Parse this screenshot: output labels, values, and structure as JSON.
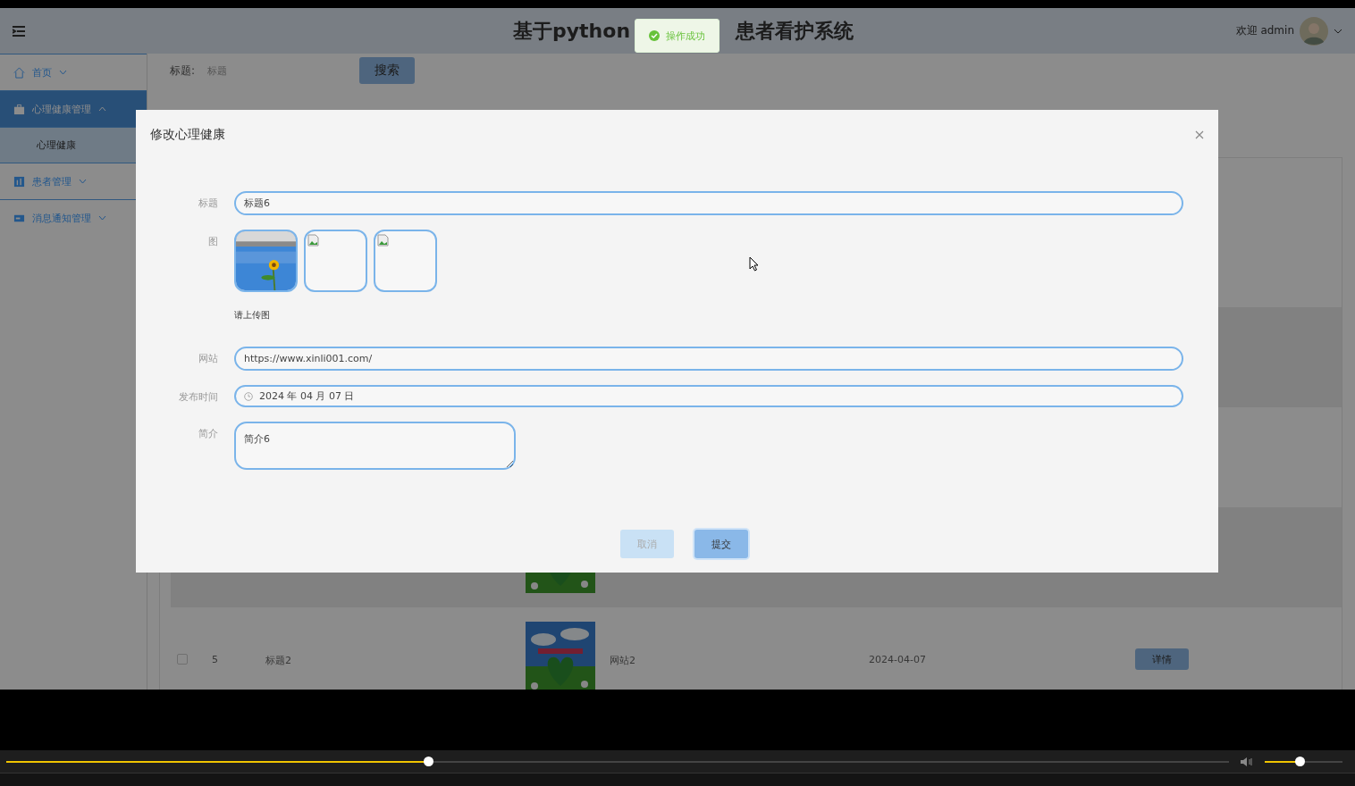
{
  "header": {
    "title_parts": [
      "基于python",
      "患者看护系统"
    ],
    "welcome": "欢迎 admin"
  },
  "toast": {
    "text": "操作成功"
  },
  "sidebar": {
    "items": [
      {
        "label": "首页",
        "kind": "home",
        "selected": false,
        "expanded": false
      },
      {
        "label": "心理健康管理",
        "kind": "briefcase",
        "selected": true,
        "expanded": true,
        "children": [
          {
            "label": "心理健康",
            "selected": false
          }
        ]
      },
      {
        "label": "患者管理",
        "kind": "chart",
        "selected": false,
        "expanded": false
      },
      {
        "label": "消息通知管理",
        "kind": "card",
        "selected": false,
        "expanded": false
      }
    ]
  },
  "search": {
    "label": "标题:",
    "placeholder": "标题",
    "button": "搜索"
  },
  "table": {
    "rows": [
      {
        "kind": "covered"
      },
      {
        "kind": "full",
        "checked": false,
        "index": "5",
        "title": "标题2",
        "site": "网站2",
        "date": "2024-04-07",
        "action": "详情"
      }
    ]
  },
  "dialog": {
    "title": "修改心理健康",
    "fields": [
      {
        "kind": "text",
        "label": "标题",
        "value": "标题6"
      },
      {
        "kind": "images",
        "label": "图",
        "images": [
          {
            "kind": "picture"
          },
          {
            "kind": "broken"
          },
          {
            "kind": "broken"
          }
        ],
        "hint": "请上传图"
      },
      {
        "kind": "text",
        "label": "网站",
        "value": "https://www.xinli001.com/"
      },
      {
        "kind": "date",
        "label": "发布时间",
        "value": "2024 年 04 月 07 日"
      },
      {
        "kind": "textarea",
        "label": "简介",
        "value": "简介6"
      }
    ],
    "buttons": [
      {
        "kind": "cancel",
        "label": "取消"
      },
      {
        "kind": "primary",
        "label": "提交"
      }
    ]
  },
  "player": {
    "progress": {
      "level": 0.345
    },
    "volume": {
      "level": 0.45
    }
  }
}
